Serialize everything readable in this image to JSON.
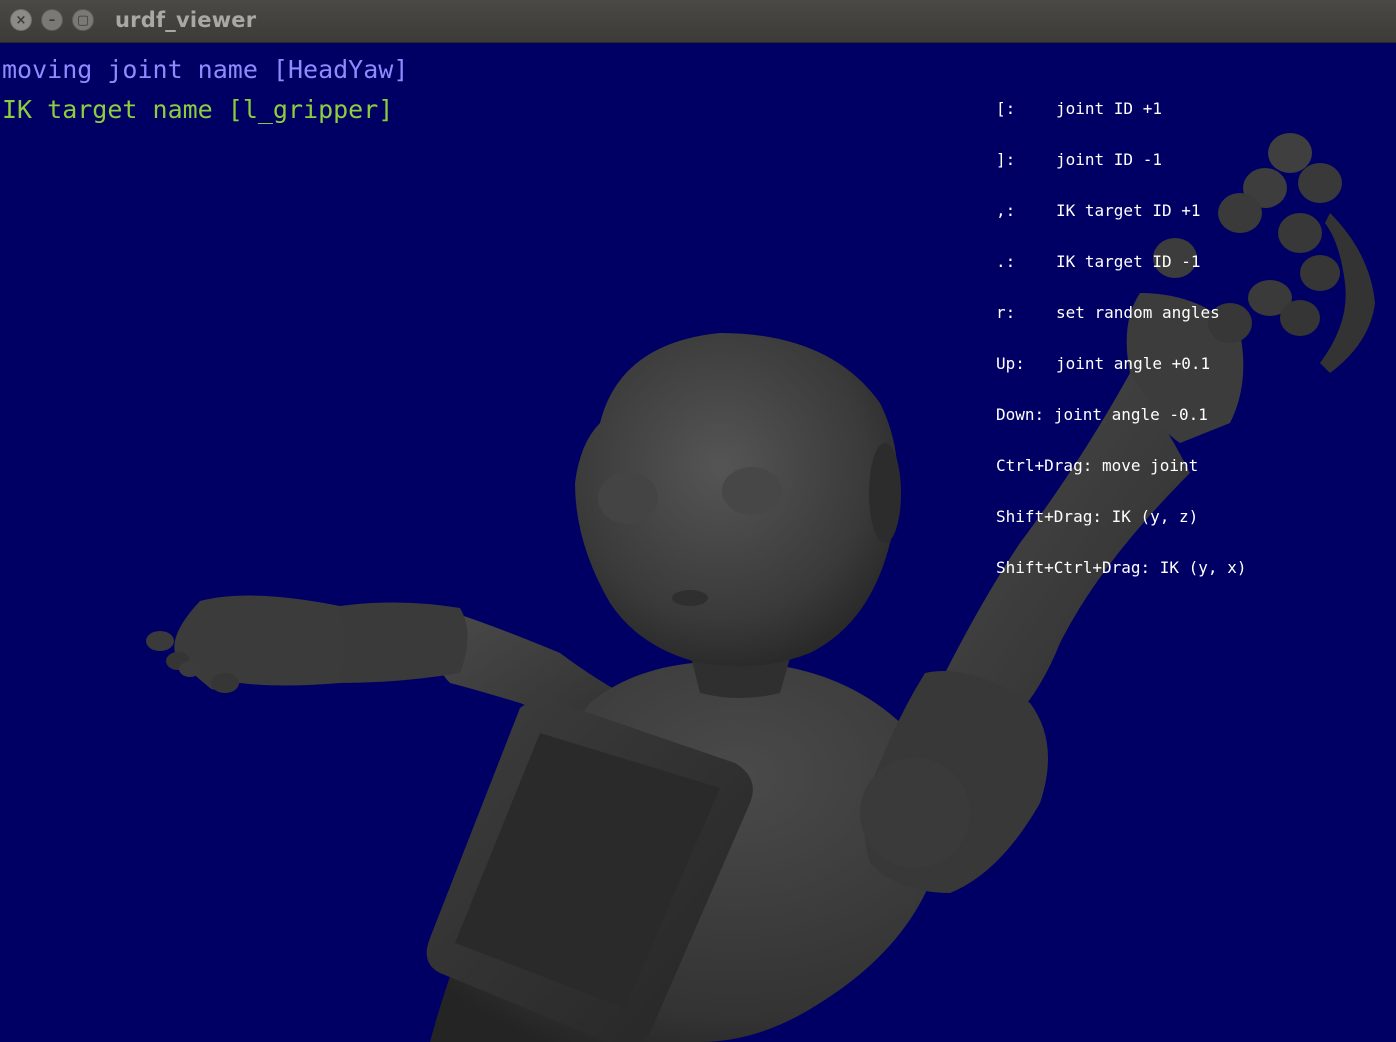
{
  "window": {
    "title": "urdf_viewer",
    "close_glyph": "×",
    "minimize_glyph": "–",
    "maximize_glyph": "▢"
  },
  "status": {
    "moving_joint": "moving joint name [HeadYaw]",
    "ik_target": "IK target name [l_gripper]"
  },
  "help": [
    {
      "key": "[:",
      "action": "joint ID +1"
    },
    {
      "key": "]:",
      "action": "joint ID -1"
    },
    {
      "key": ",:",
      "action": "IK target ID +1"
    },
    {
      "key": ".:",
      "action": "IK target ID -1"
    },
    {
      "key": "r:",
      "action": "set random angles"
    },
    {
      "key": "Up:",
      "action": "joint angle +0.1"
    },
    {
      "key": "Down:",
      "action": "joint angle -0.1"
    },
    {
      "key": "Ctrl+Drag:",
      "action": "move joint"
    },
    {
      "key": "Shift+Drag:",
      "action": "IK (y, z)"
    },
    {
      "key": "Shift+Ctrl+Drag:",
      "action": "IK (y, x)"
    }
  ],
  "colors": {
    "viewport_background": "#000064",
    "joint_text": "#8c8cff",
    "ik_text": "#8ccf3c",
    "help_text": "#ffffff",
    "robot_body": "#3a3a3a"
  }
}
